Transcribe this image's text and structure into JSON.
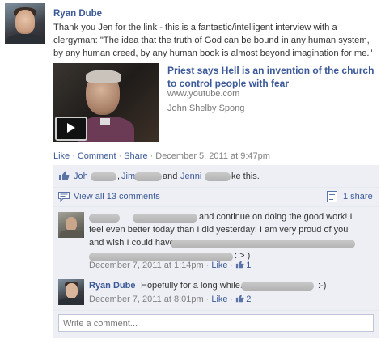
{
  "post": {
    "author": "Ryan Dube",
    "text": "Thank you Jen for the link - this is a fantastic/intelligent interview with a clergyman: \"The idea that the truth of God can be bound in any human system, by any human creed, by any human book is almost beyond imagination for me.\"",
    "shared_link": {
      "title": "Priest says Hell is an invention of the church to control people with fear",
      "domain": "www.youtube.com",
      "author": "John Shelby Spong"
    },
    "actions": {
      "like": "Like",
      "comment": "Comment",
      "share": "Share",
      "timestamp": "December 5, 2011 at 9:47pm"
    }
  },
  "likes": {
    "name1_prefix": "Joh",
    "name2_prefix": "Jim",
    "connector": "and",
    "name3_prefix": "Jenni",
    "suffix": "ke this."
  },
  "comments_bar": {
    "view_all": "View all 13 comments",
    "shares": "1 share"
  },
  "comments": [
    {
      "line1_visible": "and continue on doing the good work! I",
      "line2": "feel even better today than I did yesterday! I am very proud of you",
      "line3_prefix": "and wish I could have",
      "line4_suffix": ": > )",
      "timestamp": "December 7, 2011 at 1:14pm",
      "like": "Like",
      "like_count": "1"
    },
    {
      "author": "Ryan Dube",
      "text": "Hopefully for a long while.",
      "tail": ":-)",
      "timestamp": "December 7, 2011 at 8:01pm",
      "like": "Like",
      "like_count": "2"
    }
  ],
  "write_comment": {
    "placeholder": "Write a comment..."
  },
  "colors": {
    "link": "#3b5998",
    "ufi_bg": "#edeff4",
    "muted": "#808080"
  }
}
